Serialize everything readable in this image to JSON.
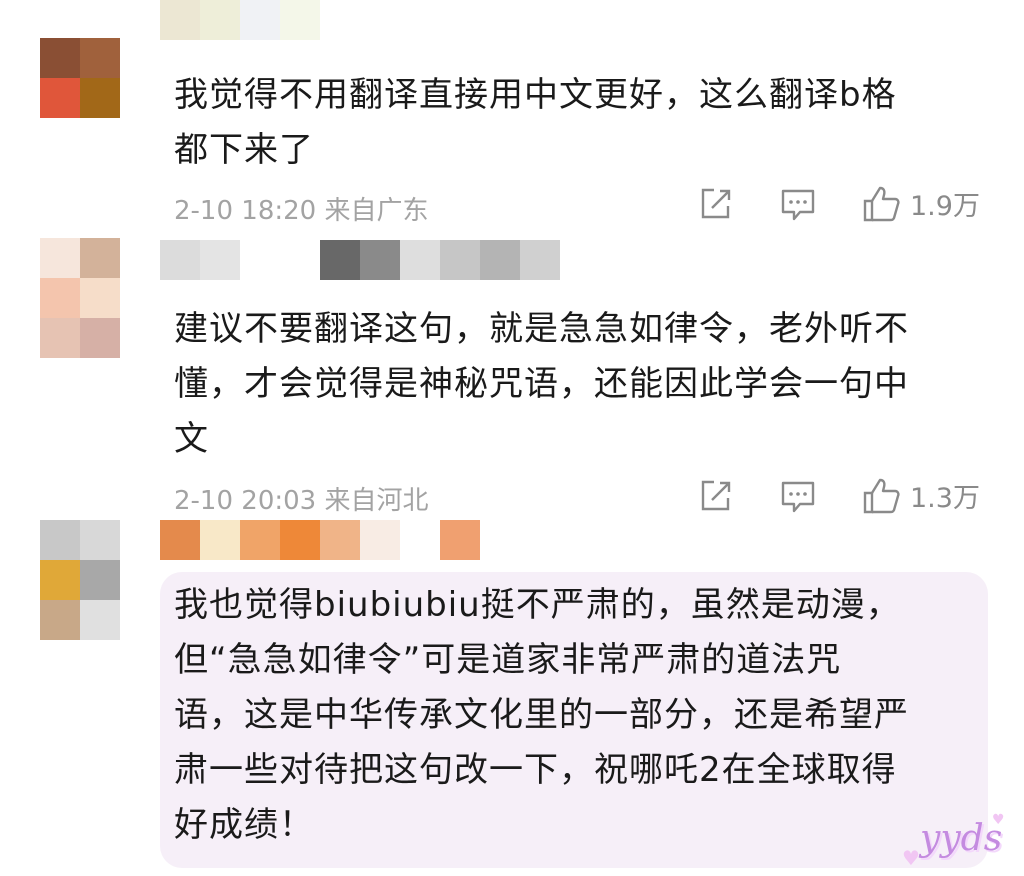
{
  "comments": [
    {
      "text": "我觉得不用翻译直接用中文更好，这么翻译b格\n都下来了",
      "time": "2-10 18:20",
      "location": "来自广东",
      "likes": "1.9万",
      "icons": {
        "share": "share-icon",
        "reply": "comment-icon",
        "like": "thumbs-up-icon"
      },
      "avatar_colors": [
        "#8a4f34",
        "#a0613c",
        "#e0563a",
        "#a26818"
      ],
      "name_colors": [
        "#ece7d3",
        "#eeeed9",
        "#f0f2f5",
        "#f4f7e9"
      ]
    },
    {
      "text": "建议不要翻译这句，就是急急如律令，老外听不\n懂，才会觉得是神秘咒语，还能因此学会一句中\n文",
      "time": "2-10 20:03",
      "location": "来自河北",
      "likes": "1.3万",
      "icons": {
        "share": "share-icon",
        "reply": "comment-icon",
        "like": "thumbs-up-icon"
      },
      "avatar_colors": [
        "#f6e6dc",
        "#d3b29a",
        "#f4c5ad",
        "#f6ddc9",
        "#e6c3b3",
        "#d6b0a6"
      ],
      "name_colors": [
        "#dcdcdc",
        "#e4e4e4",
        "transparent",
        "transparent",
        "#686868",
        "#8a8a8a",
        "#dedede",
        "#c6c6c6",
        "#b4b4b4",
        "#d0d0d0"
      ]
    },
    {
      "text": "我也觉得biubiubiu挺不严肃的，虽然是动漫，\n但“急急如律令”可是道家非常严肃的道法咒\n语，这是中华传承文化里的一部分，还是希望严\n肃一些对待把这句改一下，祝哪吒2在全球取得\n好成绩！",
      "avatar_colors": [
        "#c8c8c8",
        "#d8d8d8",
        "#e0a838",
        "#a8a8a8",
        "#c8a888",
        "#e0e0e0"
      ],
      "name_colors": [
        "#e48a4c",
        "#f8e8c8",
        "#f0a468",
        "#ee8838",
        "#f0b488",
        "#f8ece4",
        "transparent",
        "#f0a070"
      ]
    }
  ],
  "sticker": {
    "text": "yyds",
    "color": "#c48be0"
  }
}
